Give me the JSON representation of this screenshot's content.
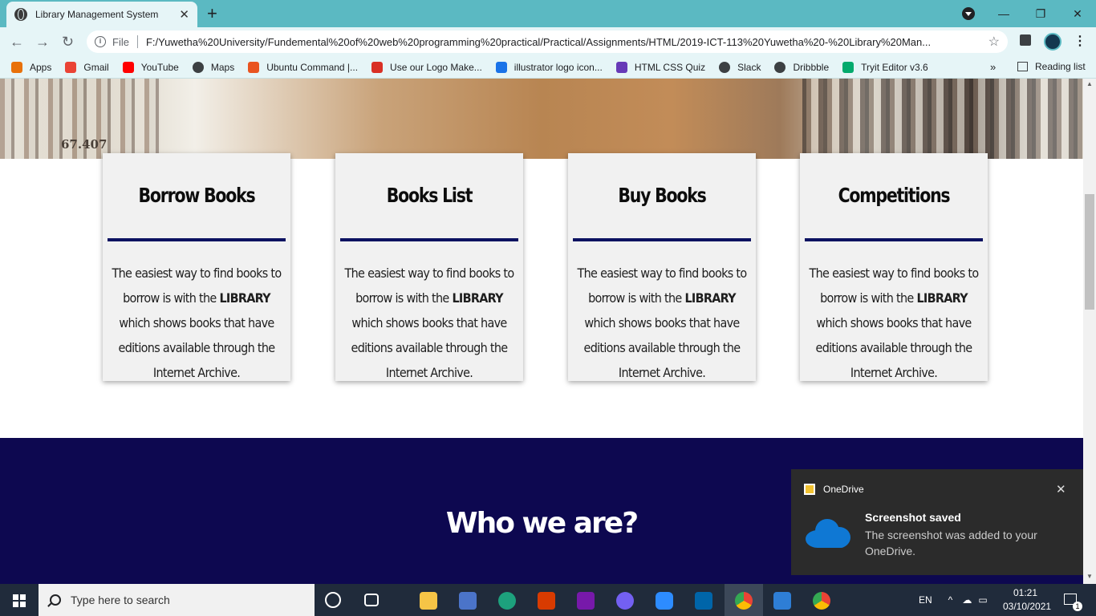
{
  "browser": {
    "tab_title": "Library Management System",
    "omnibox_scheme": "File",
    "url": "F:/Yuwetha%20University/Fundemental%20of%20web%20programming%20practical/Practical/Assignments/HTML/2019-ICT-113%20Yuwetha%20-%20Library%20Man...",
    "bookmarks": [
      {
        "label": "Apps",
        "icon": "apps-grid-icon",
        "color": "#e8710a"
      },
      {
        "label": "Gmail",
        "icon": "gmail-icon",
        "color": "#ea4335"
      },
      {
        "label": "YouTube",
        "icon": "youtube-icon",
        "color": "#ff0000"
      },
      {
        "label": "Maps",
        "icon": "globe-icon",
        "color": "#3c4043"
      },
      {
        "label": "Ubuntu Command |...",
        "icon": "ubuntu-icon",
        "color": "#e95420"
      },
      {
        "label": "Use our Logo Make...",
        "icon": "pepper-icon",
        "color": "#d93025"
      },
      {
        "label": "illustrator logo icon...",
        "icon": "bing-icon",
        "color": "#1a73e8"
      },
      {
        "label": "HTML CSS Quiz",
        "icon": "quiz-icon",
        "color": "#673ab7"
      },
      {
        "label": "Slack",
        "icon": "globe-icon",
        "color": "#3c4043"
      },
      {
        "label": "Dribbble",
        "icon": "globe-icon",
        "color": "#3c4043"
      },
      {
        "label": "Tryit Editor v3.6",
        "icon": "w3-icon",
        "color": "#04aa6d"
      }
    ],
    "reading_list": "Reading list",
    "more_bookmarks": "»"
  },
  "hero": {
    "shelf_label": "67.407"
  },
  "cards": [
    {
      "title": "Borrow Books",
      "text_before": "The easiest way to find books to borrow is with the ",
      "highlight": "LIBRARY",
      "text_after": " which shows books that have editions available through the Internet Archive."
    },
    {
      "title": "Books List",
      "text_before": "The easiest way to find books to borrow is with the ",
      "highlight": "LIBRARY",
      "text_after": " which shows books that have editions available through the Internet Archive."
    },
    {
      "title": "Buy Books",
      "text_before": "The easiest way to find books to borrow is with the ",
      "highlight": "LIBRARY",
      "text_after": " which shows books that have editions available through the Internet Archive."
    },
    {
      "title": "Competitions",
      "text_before": "The easiest way to find books to borrow is with the ",
      "highlight": "LIBRARY",
      "text_after": " which shows books that have editions available through the Internet Archive."
    }
  ],
  "about": {
    "heading": "Who we are?"
  },
  "toast": {
    "app": "OneDrive",
    "title": "Screenshot saved",
    "message": "The screenshot was added to your OneDrive."
  },
  "taskbar": {
    "search_placeholder": "Type here to search",
    "language": "EN",
    "time": "01:21",
    "date": "03/10/2021",
    "notification_count": "1"
  },
  "colors": {
    "chrome_frame": "#5bb9c2",
    "card_bar": "#0c1261",
    "dark_section": "#0d0850",
    "onedrive_blue": "#0f78d4"
  }
}
